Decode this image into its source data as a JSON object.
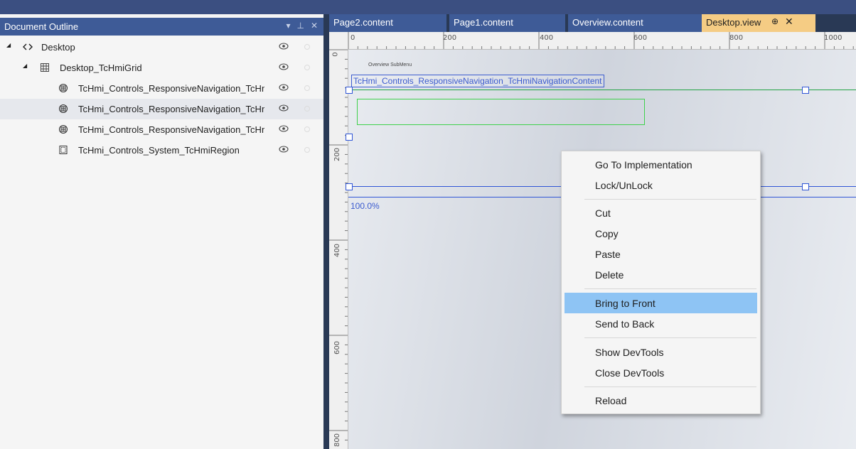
{
  "outline": {
    "title": "Document Outline",
    "header_icons": [
      "dropdown-icon",
      "pin-icon",
      "close-icon"
    ],
    "tree": [
      {
        "label": "Desktop",
        "level": 0,
        "icon": "code-tag-icon",
        "expanded": true,
        "selected": false
      },
      {
        "label": "Desktop_TcHmiGrid",
        "level": 1,
        "icon": "grid-icon",
        "expanded": true,
        "selected": false
      },
      {
        "label": "TcHmi_Controls_ResponsiveNavigation_TcHmiNavigationContent",
        "level": 2,
        "icon": "navigation-control-icon",
        "selected": false
      },
      {
        "label": "TcHmi_Controls_ResponsiveNavigation_TcHmiNavigationContent",
        "level": 2,
        "icon": "navigation-control-icon",
        "selected": true
      },
      {
        "label": "TcHmi_Controls_ResponsiveNavigation_TcHmiNavigationContent",
        "level": 2,
        "icon": "navigation-control-icon",
        "selected": false
      },
      {
        "label": "TcHmi_Controls_System_TcHmiRegion",
        "level": 2,
        "icon": "region-control-icon",
        "selected": false
      }
    ]
  },
  "tabs": [
    {
      "label": "Page2.content",
      "active": false
    },
    {
      "label": "Page1.content",
      "active": false
    },
    {
      "label": "Overview.content",
      "active": false
    },
    {
      "label": "Desktop.view",
      "active": true,
      "pin": "⊕",
      "close": "✕"
    }
  ],
  "ruler": {
    "top_labels": [
      "0",
      "200",
      "400",
      "600",
      "800",
      "1000"
    ],
    "left_labels": [
      "0",
      "200",
      "400",
      "600",
      "800"
    ]
  },
  "canvas": {
    "nav_mini_text": "Overview    SubMenu",
    "nav_control_label": "TcHmi_Controls_ResponsiveNavigation_TcHmiNavigationContent",
    "zoom": "100.0%"
  },
  "context_menu": {
    "items": [
      {
        "label": "Go To Implementation",
        "highlighted": false
      },
      {
        "label": "Lock/UnLock",
        "highlighted": false
      },
      {
        "separator": true
      },
      {
        "label": "Cut",
        "highlighted": false
      },
      {
        "label": "Copy",
        "highlighted": false
      },
      {
        "label": "Paste",
        "highlighted": false
      },
      {
        "label": "Delete",
        "highlighted": false
      },
      {
        "separator": true
      },
      {
        "label": "Bring to Front",
        "highlighted": true
      },
      {
        "label": "Send to Back",
        "highlighted": false
      },
      {
        "separator": true
      },
      {
        "label": "Show DevTools",
        "highlighted": false
      },
      {
        "label": "Close DevTools",
        "highlighted": false
      },
      {
        "separator": true
      },
      {
        "label": "Reload",
        "highlighted": false
      }
    ]
  },
  "colors": {
    "header_blue": "#3e5b97",
    "active_tab": "#f5cc84",
    "menu_highlight": "#8ec4f4",
    "selection_blue": "#2f55d6"
  }
}
